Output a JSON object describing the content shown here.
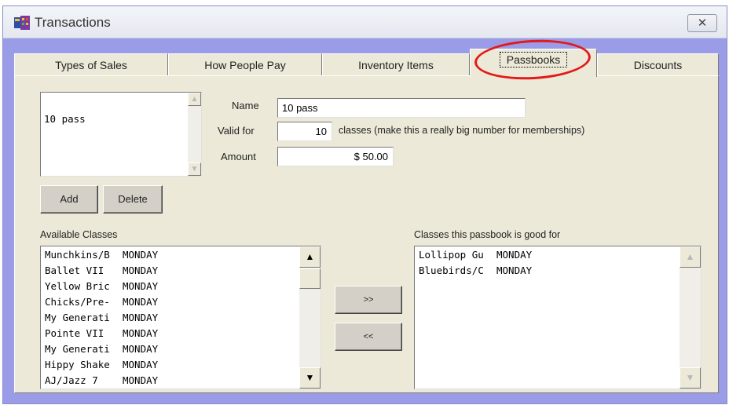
{
  "window": {
    "title": "Transactions",
    "close_glyph": "✕"
  },
  "tabs": [
    {
      "label": "Types of Sales"
    },
    {
      "label": "How People Pay"
    },
    {
      "label": "Inventory Items"
    },
    {
      "label": "Passbooks"
    },
    {
      "label": "Discounts"
    }
  ],
  "passbooks": {
    "list_items": [
      "10 pass"
    ],
    "name_label": "Name",
    "name_value": "10 pass",
    "valid_for_label": "Valid for",
    "valid_for_value": "10",
    "valid_for_hint": "classes (make this a really big number for memberships)",
    "amount_label": "Amount",
    "amount_value": "$ 50.00",
    "add_label": "Add",
    "delete_label": "Delete"
  },
  "available_classes": {
    "label": "Available Classes",
    "rows": [
      [
        "Munchkins/B",
        "MONDAY"
      ],
      [
        "Ballet VII",
        "MONDAY"
      ],
      [
        "Yellow Bric",
        "MONDAY"
      ],
      [
        "Chicks/Pre-",
        "MONDAY"
      ],
      [
        "My Generati",
        "MONDAY"
      ],
      [
        "Pointe VII",
        "MONDAY"
      ],
      [
        "My Generati",
        "MONDAY"
      ],
      [
        "Hippy Shake",
        "MONDAY"
      ],
      [
        "AJ/Jazz 7",
        "MONDAY"
      ]
    ]
  },
  "transfer": {
    "add_label": ">>",
    "remove_label": "<<"
  },
  "good_for_classes": {
    "label": "Classes this passbook is good for",
    "rows": [
      [
        "Lollipop Gu",
        "MONDAY"
      ],
      [
        "Bluebirds/C",
        "MONDAY"
      ]
    ]
  },
  "icons": {
    "scroll_up": "▲",
    "scroll_down": "▼",
    "app": "transactions-app-icon"
  },
  "colors": {
    "frame": "#9a9ce8",
    "panel": "#ece9d8",
    "annotation": "#e21a1a"
  }
}
